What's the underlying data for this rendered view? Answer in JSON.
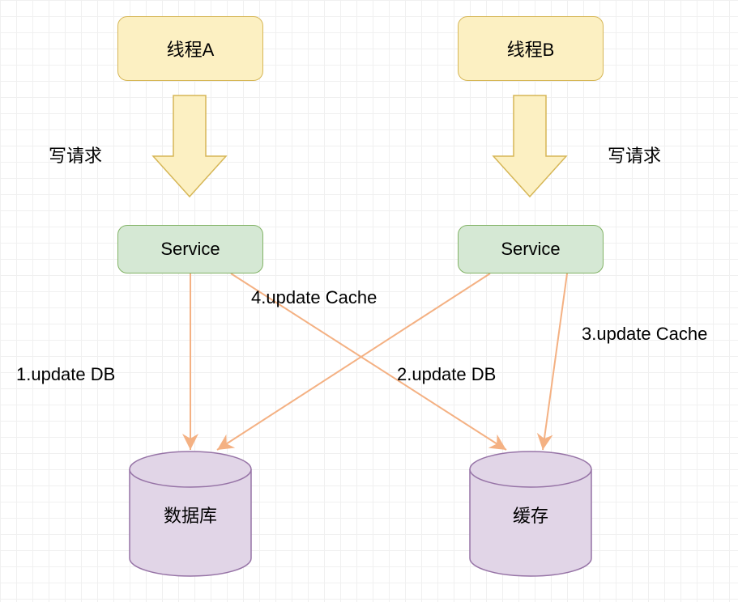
{
  "threads": {
    "a": {
      "label": "线程A"
    },
    "b": {
      "label": "线程B"
    }
  },
  "requests": {
    "a": "写请求",
    "b": "写请求"
  },
  "services": {
    "a": "Service",
    "b": "Service"
  },
  "operations": {
    "op1": "1.update DB",
    "op2": "2.update DB",
    "op3": "3.update Cache",
    "op4": "4.update Cache"
  },
  "stores": {
    "db": "数据库",
    "cache": "缓存"
  },
  "colors": {
    "thread_fill": "#fcf0c2",
    "thread_stroke": "#d6b656",
    "service_fill": "#d5e8d4",
    "service_stroke": "#82b366",
    "cylinder_fill": "#e1d5e7",
    "cylinder_stroke": "#9673a6",
    "arrow": "#f4b183",
    "arrow_fill": "#fcf0c2"
  }
}
